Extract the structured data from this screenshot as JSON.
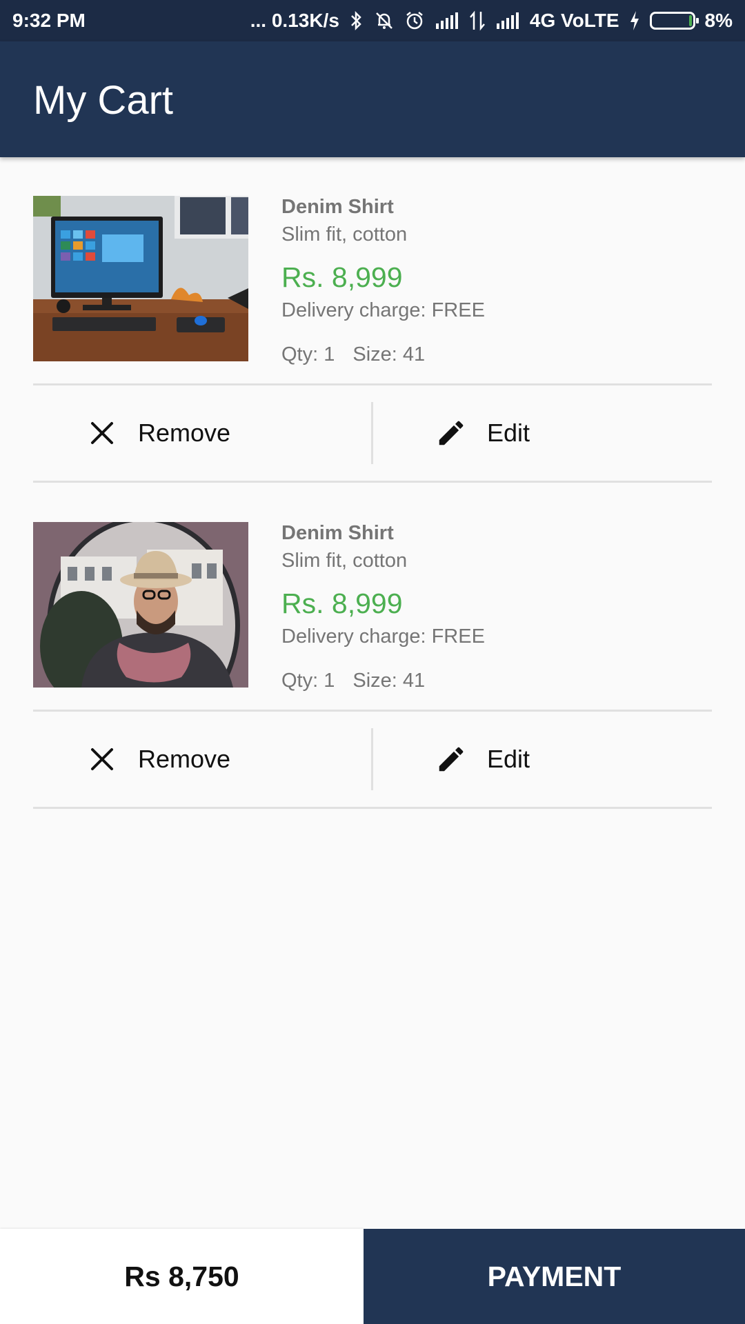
{
  "status_bar": {
    "time": "9:32 PM",
    "network_speed": "... 0.13K/s",
    "network_type": "4G VoLTE",
    "battery_percent": "8%",
    "battery_level": 0.08,
    "icons": [
      "bluetooth-icon",
      "bell-off-icon",
      "alarm-icon",
      "signal-icon",
      "data-arrows-icon",
      "signal-icon",
      "charging-icon",
      "battery-icon"
    ]
  },
  "app_bar": {
    "title": "My Cart"
  },
  "cart": {
    "items": [
      {
        "image": "desk-computer-photo",
        "name": "Denim Shirt",
        "description": "Slim fit, cotton",
        "price": "Rs. 8,999",
        "delivery": "Delivery charge: FREE",
        "qty": "Qty: 1",
        "size": "Size: 41",
        "remove_label": "Remove",
        "edit_label": "Edit"
      },
      {
        "image": "man-with-hat-photo",
        "name": "Denim Shirt",
        "description": "Slim fit, cotton",
        "price": "Rs. 8,999",
        "delivery": "Delivery charge: FREE",
        "qty": "Qty: 1",
        "size": "Size: 41",
        "remove_label": "Remove",
        "edit_label": "Edit"
      }
    ]
  },
  "footer": {
    "total": "Rs 8,750",
    "payment_label": "PAYMENT"
  },
  "colors": {
    "primary": "#213554",
    "status_bar": "#1c2b45",
    "price_green": "#4caf50",
    "background": "#fafafa"
  }
}
